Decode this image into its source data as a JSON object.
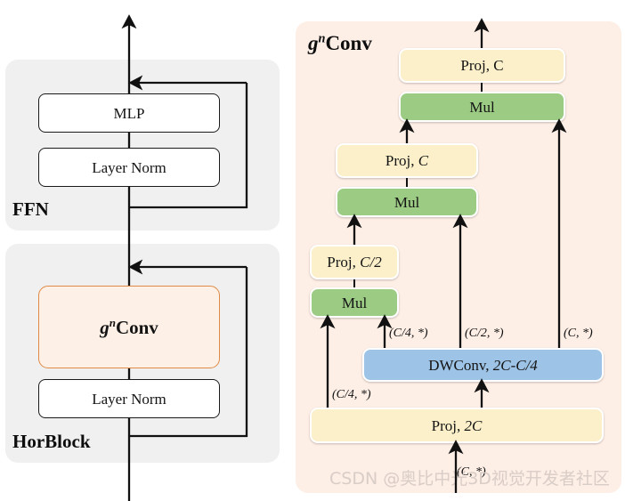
{
  "figure": {
    "title": "HorBlock and g^nConv architecture diagram"
  },
  "left_panel": {
    "ffn": {
      "caption": "FFN",
      "blocks": [
        {
          "label": "MLP",
          "style": "white"
        },
        {
          "label": "Layer Norm",
          "style": "white"
        }
      ]
    },
    "horblock": {
      "caption": "HorBlock",
      "blocks": [
        {
          "label_g": "g",
          "label_sup": "n",
          "label_rest": "Conv",
          "style": "orange"
        },
        {
          "label": "Layer Norm",
          "style": "white"
        }
      ]
    }
  },
  "right_panel": {
    "caption_g": "g",
    "caption_sup": "n",
    "caption_rest": "Conv",
    "blocks": {
      "proj_c_top": "Proj, C",
      "mul_top": "Mul",
      "proj_c_mid_pre": "Proj, ",
      "proj_c_mid_var": "C",
      "mul_mid": "Mul",
      "proj_c2_pre": "Proj, ",
      "proj_c2_var": "C/2",
      "mul_bottom": "Mul",
      "dwconv_pre": "DWConv, ",
      "dwconv_var": "2C-C/4",
      "proj_2c_pre": "Proj, ",
      "proj_2c_var": "2C"
    },
    "dims": {
      "c4_left": "(C/4, *)",
      "c4_dw": "(C/4, *)",
      "c2": "(C/2, *)",
      "c": "(C, *)",
      "input": "(C, *)"
    }
  },
  "watermark": {
    "text": "CSDN @奥比中光3D视觉开发者社区"
  },
  "colors": {
    "panel_grey": "#f0f0f0",
    "panel_pink": "#fdeee6",
    "box_yellow": "#fbf0c9",
    "box_green": "#9ccb84",
    "box_blue": "#9dc3e6",
    "box_orange_fill": "#fdf0e6",
    "box_orange_border": "#e08a45",
    "stroke": "#1a1a1a"
  }
}
